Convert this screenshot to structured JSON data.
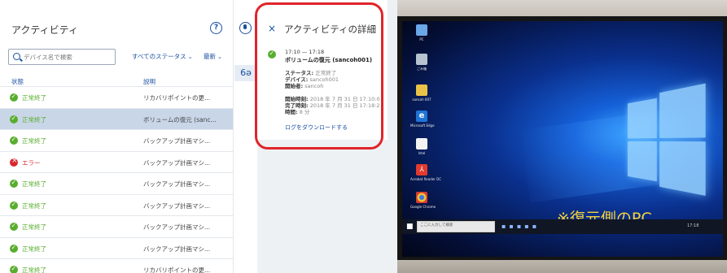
{
  "activity_panel": {
    "title": "アクティビティ",
    "help_icon_glyph": "?",
    "search": {
      "value": "",
      "placeholder": "デバイス名で検索"
    },
    "filters": {
      "status": "すべてのステータス",
      "sort": "最新"
    },
    "columns": {
      "status": "状態",
      "description": "説明"
    },
    "rows": [
      {
        "status": "正常終了",
        "type": "ok",
        "description": "リカバリポイントの更...",
        "selected": false
      },
      {
        "status": "正常終了",
        "type": "ok",
        "description": "ボリュームの復元 (sanc...",
        "selected": true
      },
      {
        "status": "正常終了",
        "type": "ok",
        "description": "バックアップ計画マシ...",
        "selected": false
      },
      {
        "status": "エラー",
        "type": "error",
        "description": "バックアップ計画マシ...",
        "selected": false
      },
      {
        "status": "正常終了",
        "type": "ok",
        "description": "バックアップ計画マシ...",
        "selected": false
      },
      {
        "status": "正常終了",
        "type": "ok",
        "description": "バックアップ計画マシ...",
        "selected": false
      },
      {
        "status": "正常終了",
        "type": "ok",
        "description": "バックアップ計画マシ...",
        "selected": false
      },
      {
        "status": "正常終了",
        "type": "ok",
        "description": "バックアップ計画マシ...",
        "selected": false
      },
      {
        "status": "正常終了",
        "type": "ok",
        "description": "リカバリポイントの更...",
        "selected": false
      }
    ]
  },
  "toolbar": {
    "glasses_glyph": "6ə"
  },
  "detail_panel": {
    "close_glyph": "×",
    "title": "アクティビティの詳細",
    "time_range": "17:10 — 17:18",
    "activity_name": "ボリュームの復元 (sancoh001)",
    "status_label": "ステータス:",
    "status_value": "正常終了",
    "device_label": "デバイス:",
    "device_value": "sancoh001",
    "initiator_label": "開始者:",
    "initiator_value": "sancoh",
    "start_label": "開始時刻:",
    "start_value": "2018 年 7 月 31 日 17:10:0",
    "end_label": "完了時刻:",
    "end_value": "2018 年 7 月 31 日 17:18:2",
    "duration_label": "時間:",
    "duration_value": "8 分",
    "download_link": "ログをダウンロードする"
  },
  "photo": {
    "overlay_text": "※復元側のPC",
    "desktop_icons": [
      {
        "label": "PC",
        "icon": "pc-icon"
      },
      {
        "label": "ごみ箱",
        "icon": "recycle-bin-icon"
      },
      {
        "label": "sancoh 007",
        "icon": "scanner-icon"
      },
      {
        "label": "Microsoft Edge",
        "icon": "edge-icon"
      },
      {
        "label": "Intel",
        "icon": "document-icon"
      },
      {
        "label": "Acrobat Reader DC",
        "icon": "pdf-icon"
      },
      {
        "label": "Google Chrome",
        "icon": "chrome-icon"
      }
    ],
    "taskbar": {
      "search_text": "ここに入力して検索",
      "clock": "17:18"
    }
  },
  "colors": {
    "accent": "#1a4fa0",
    "success": "#59ad2f",
    "error": "#d9272e",
    "highlight": "#e0242b",
    "overlay": "#f5d23a"
  }
}
